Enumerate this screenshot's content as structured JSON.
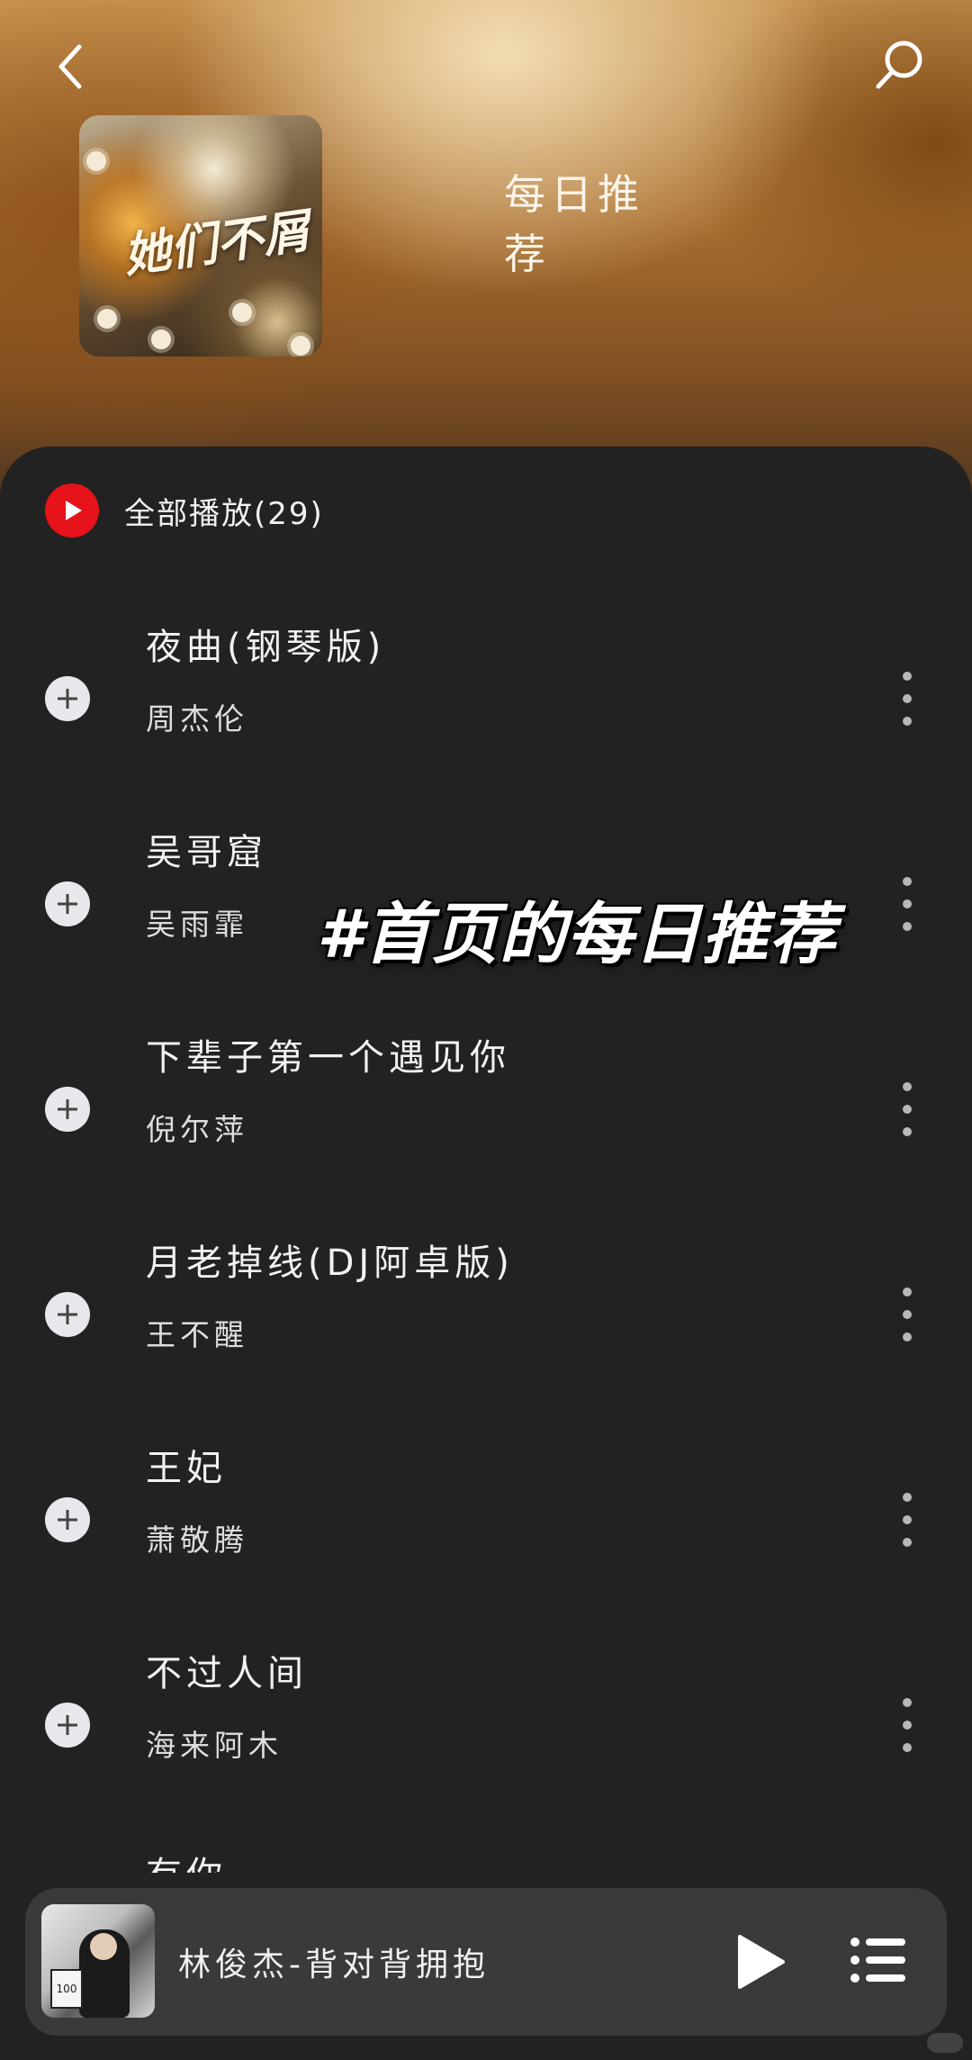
{
  "header": {
    "title": "每日推荐",
    "back_icon": "chevron-left-icon",
    "search_icon": "search-icon",
    "album_art_text": "她们不屑"
  },
  "play_all": {
    "label": "全部播放(29)",
    "accent": "#e6131b"
  },
  "songs": [
    {
      "title": "夜曲(钢琴版)",
      "artist": "周杰伦"
    },
    {
      "title": "吴哥窟",
      "artist": "吴雨霏"
    },
    {
      "title": "下辈子第一个遇见你",
      "artist": "倪尔萍"
    },
    {
      "title": "月老掉线(DJ阿卓版)",
      "artist": "王不醒"
    },
    {
      "title": "王妃",
      "artist": "萧敬腾"
    },
    {
      "title": "不过人间",
      "artist": "海来阿木"
    },
    {
      "title": "有你",
      "artist": ""
    }
  ],
  "overlay_caption": "#首页的每日推荐",
  "mini_player": {
    "track": "林俊杰-背对背拥抱",
    "play_icon": "play-icon",
    "playlist_icon": "playlist-icon"
  },
  "colors": {
    "panel_bg": "#222222",
    "mini_player_bg": "#3a3a3a"
  }
}
